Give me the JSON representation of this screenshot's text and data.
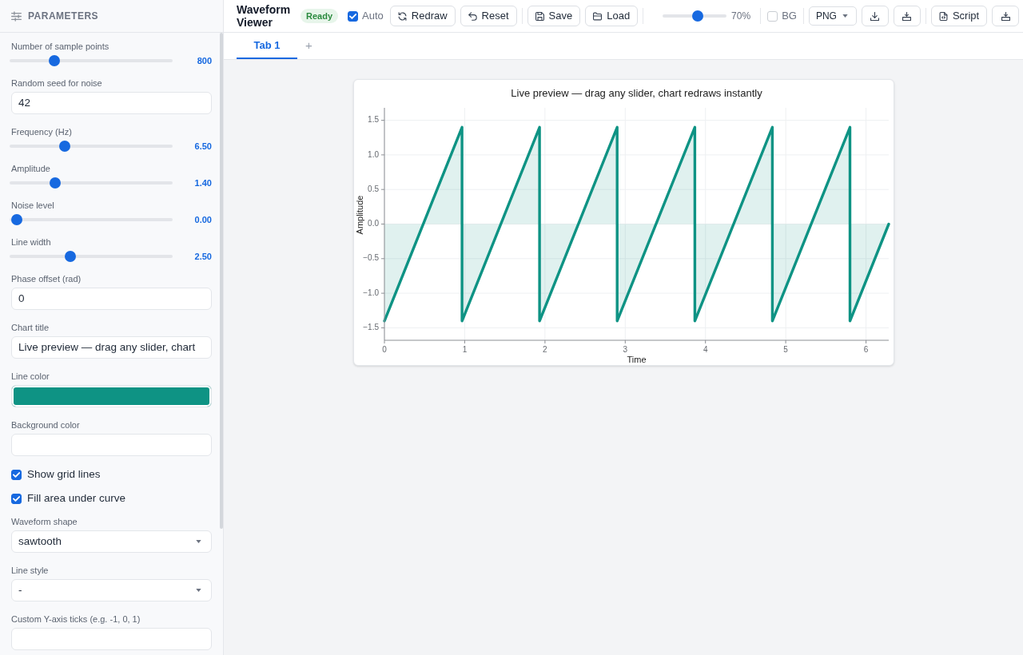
{
  "sidebar": {
    "title": "PARAMETERS",
    "params": [
      {
        "kind": "slider",
        "label": "Number of sample points",
        "level": 0.25,
        "reading": "800"
      },
      {
        "kind": "input",
        "label": "Random seed for noise",
        "value": "42"
      },
      {
        "kind": "slider",
        "label": "Frequency (Hz)",
        "level": 0.32,
        "reading": "6.50"
      },
      {
        "kind": "slider",
        "label": "Amplitude",
        "level": 0.26,
        "reading": "1.40"
      },
      {
        "kind": "slider",
        "label": "Noise level",
        "level": 0,
        "reading": "0.00"
      },
      {
        "kind": "slider",
        "label": "Line width",
        "level": 0.36,
        "reading": "2.50"
      },
      {
        "kind": "input",
        "label": "Phase offset (rad)",
        "value": "0"
      },
      {
        "kind": "input",
        "label": "Chart title",
        "value": "Live preview — drag any slider, chart"
      },
      {
        "kind": "color",
        "label": "Line color",
        "color": "#0e9384"
      },
      {
        "kind": "color",
        "label": "Background color",
        "color": "#ffffff"
      },
      {
        "kind": "checkbox",
        "label": "Show grid lines",
        "checked": true
      },
      {
        "kind": "checkbox",
        "label": "Fill area under curve",
        "checked": true
      },
      {
        "kind": "select",
        "label": "Waveform shape",
        "value": "sawtooth"
      },
      {
        "kind": "select",
        "label": "Line style",
        "value": "-"
      },
      {
        "kind": "input",
        "label": "Custom Y-axis ticks (e.g. -1, 0, 1)"
      }
    ]
  },
  "toolbar": {
    "title": "Waveform Viewer",
    "status": "Ready",
    "groups": [
      [
        {
          "kind": "checkbox",
          "label": "Auto",
          "checked": true
        },
        {
          "kind": "button",
          "label": "Redraw"
        },
        {
          "kind": "button",
          "label": "Reset"
        }
      ],
      [
        {
          "kind": "button",
          "label": "Save"
        },
        {
          "kind": "button",
          "label": "Load"
        }
      ],
      [
        {
          "kind": "slider",
          "level": 0.56,
          "reading": "70%"
        }
      ],
      [
        {
          "kind": "checkbox",
          "label": "BG",
          "checked": false
        }
      ],
      [
        {
          "kind": "select",
          "value": "PNG"
        },
        {
          "kind": "icon_button"
        },
        {
          "kind": "icon_button"
        }
      ],
      [
        {
          "kind": "button",
          "label": "Script"
        },
        {
          "kind": "icon_button"
        }
      ]
    ]
  },
  "tabs": [
    {
      "label": "Tab 1",
      "selected": true
    }
  ],
  "add_tab": "+",
  "chart": {
    "chart_data": {
      "type": "area",
      "title": "Live preview — drag any slider, chart redraws instantly",
      "xlabel": "Time",
      "ylabel": "Amplitude",
      "grid": true,
      "x": [
        0,
        0.967,
        0.967,
        1.933,
        1.933,
        2.9,
        2.9,
        3.867,
        3.867,
        4.833,
        4.833,
        5.8,
        5.8,
        6.283
      ],
      "series": [
        {
          "color": "#0e9384",
          "values": [
            -1.4,
            1.4,
            -1.4,
            1.4,
            -1.4,
            1.4,
            -1.4,
            1.4,
            -1.4,
            1.4,
            -1.4,
            1.4,
            -1.4,
            0
          ]
        }
      ],
      "xlim": [
        0,
        6.283
      ],
      "ylim": [
        -1.68,
        1.68
      ],
      "xticks": [
        0,
        1,
        2,
        3,
        4,
        5,
        6
      ],
      "yticks": [
        {
          "value": -1.5,
          "label": "−1.5"
        },
        {
          "value": -1,
          "label": "−1.0"
        },
        {
          "value": -0.5,
          "label": "−0.5"
        },
        {
          "value": 0,
          "label": "0.0"
        },
        {
          "value": 0.5,
          "label": "0.5"
        },
        {
          "value": 1,
          "label": "1.0"
        },
        {
          "value": 1.5,
          "label": "1.5"
        }
      ]
    }
  }
}
